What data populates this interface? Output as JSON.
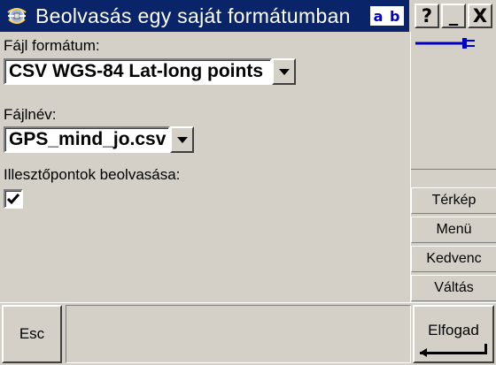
{
  "window": {
    "title": "Beolvasás egy saját formátumban",
    "input_mode": "a b",
    "app_icon": "satellite-icon",
    "caption_buttons": {
      "help": "?",
      "minimize": "_",
      "close": "X"
    }
  },
  "form": {
    "file_format": {
      "label": "Fájl formátum:",
      "value": "CSV WGS-84 Lat-long points"
    },
    "file_name": {
      "label": "Fájlnév:",
      "value": "GPS_mind_jo.csv"
    },
    "load_control_points": {
      "label": "Illesztőpontok beolvasása:",
      "checked": true
    }
  },
  "sidebar": {
    "gps_status_icon": "gps-connection-icon",
    "buttons": [
      {
        "label": "Térkép"
      },
      {
        "label": "Menü"
      },
      {
        "label": "Kedvenc"
      },
      {
        "label": "Váltás"
      }
    ]
  },
  "bottom": {
    "esc_label": "Esc",
    "accept_label": "Elfogad"
  },
  "colors": {
    "titlebar": "#0a246a",
    "face": "#d4d0c8",
    "gps_line": "#0000c0"
  }
}
